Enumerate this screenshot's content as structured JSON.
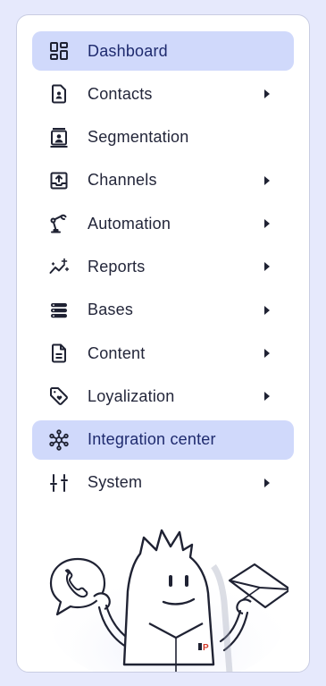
{
  "nav": {
    "items": [
      {
        "label": "Dashboard",
        "icon": "dashboard-icon",
        "active": true,
        "has_submenu": false
      },
      {
        "label": "Contacts",
        "icon": "contact-card-icon",
        "active": false,
        "has_submenu": true
      },
      {
        "label": "Segmentation",
        "icon": "segmentation-icon",
        "active": false,
        "has_submenu": false
      },
      {
        "label": "Channels",
        "icon": "inbox-upload-icon",
        "active": false,
        "has_submenu": true
      },
      {
        "label": "Automation",
        "icon": "robot-arm-icon",
        "active": false,
        "has_submenu": true
      },
      {
        "label": "Reports",
        "icon": "sparkle-chart-icon",
        "active": false,
        "has_submenu": true
      },
      {
        "label": "Bases",
        "icon": "database-icon",
        "active": false,
        "has_submenu": true
      },
      {
        "label": "Content",
        "icon": "document-icon",
        "active": false,
        "has_submenu": true
      },
      {
        "label": "Loyalization",
        "icon": "tag-heart-icon",
        "active": false,
        "has_submenu": true
      },
      {
        "label": "Integration center",
        "icon": "network-hub-icon",
        "active": true,
        "has_submenu": false
      },
      {
        "label": "System",
        "icon": "sliders-icon",
        "active": false,
        "has_submenu": true
      }
    ]
  },
  "mascot": {
    "name": "mascot-illustration",
    "logo_text": "P"
  },
  "colors": {
    "background": "#e6e9fc",
    "panel": "#ffffff",
    "active": "#d0d9fb",
    "text": "#23263a",
    "accent": "#d23a2a"
  }
}
